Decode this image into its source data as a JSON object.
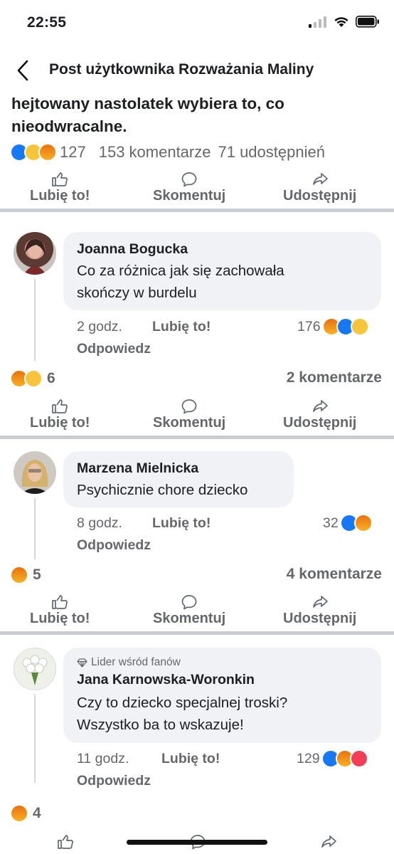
{
  "status": {
    "time": "22:55"
  },
  "header": {
    "title": "Post użytkownika Rozważania Maliny"
  },
  "post": {
    "text_line1": "hejtowany nastolatek wybiera to, co",
    "text_line2": "nieodwracalne.",
    "reaction_count": "127",
    "comments": "153 komentarze",
    "shares": "71 udostępnień"
  },
  "actions": {
    "like": "Lubię to!",
    "comment": "Skomentuj",
    "share": "Udostępnij"
  },
  "comments": [
    {
      "name": "Joanna Bogucka",
      "line1": "Co za różnica jak się zachowała",
      "line2": "skończy w burdelu",
      "time": "2 godz.",
      "like": "Lubię to!",
      "reply": "Odpowiedz",
      "reactions": "176",
      "summary_reactions": "6",
      "summary_comments": "2 komentarze"
    },
    {
      "name": "Marzena Mielnicka",
      "line1": "Psychicznie chore dziecko",
      "time": "8 godz.",
      "like": "Lubię to!",
      "reply": "Odpowiedz",
      "reactions": "32",
      "summary_reactions": "5",
      "summary_comments": "4 komentarze"
    },
    {
      "badge": "Lider wśród fanów",
      "name": "Jana Karnowska-Woronkin",
      "line1": "Czy to dziecko specjalnej troski?",
      "line2": "Wszystko ba to wskazuje!",
      "time": "11 godz.",
      "like": "Lubię to!",
      "reply": "Odpowiedz",
      "reactions": "129",
      "summary_reactions": "4"
    }
  ],
  "colors": {
    "like_blue": "#1877f2",
    "secondary_text": "#65676b",
    "bubble": "#f0f2f5",
    "divider": "#c9ccd1"
  }
}
